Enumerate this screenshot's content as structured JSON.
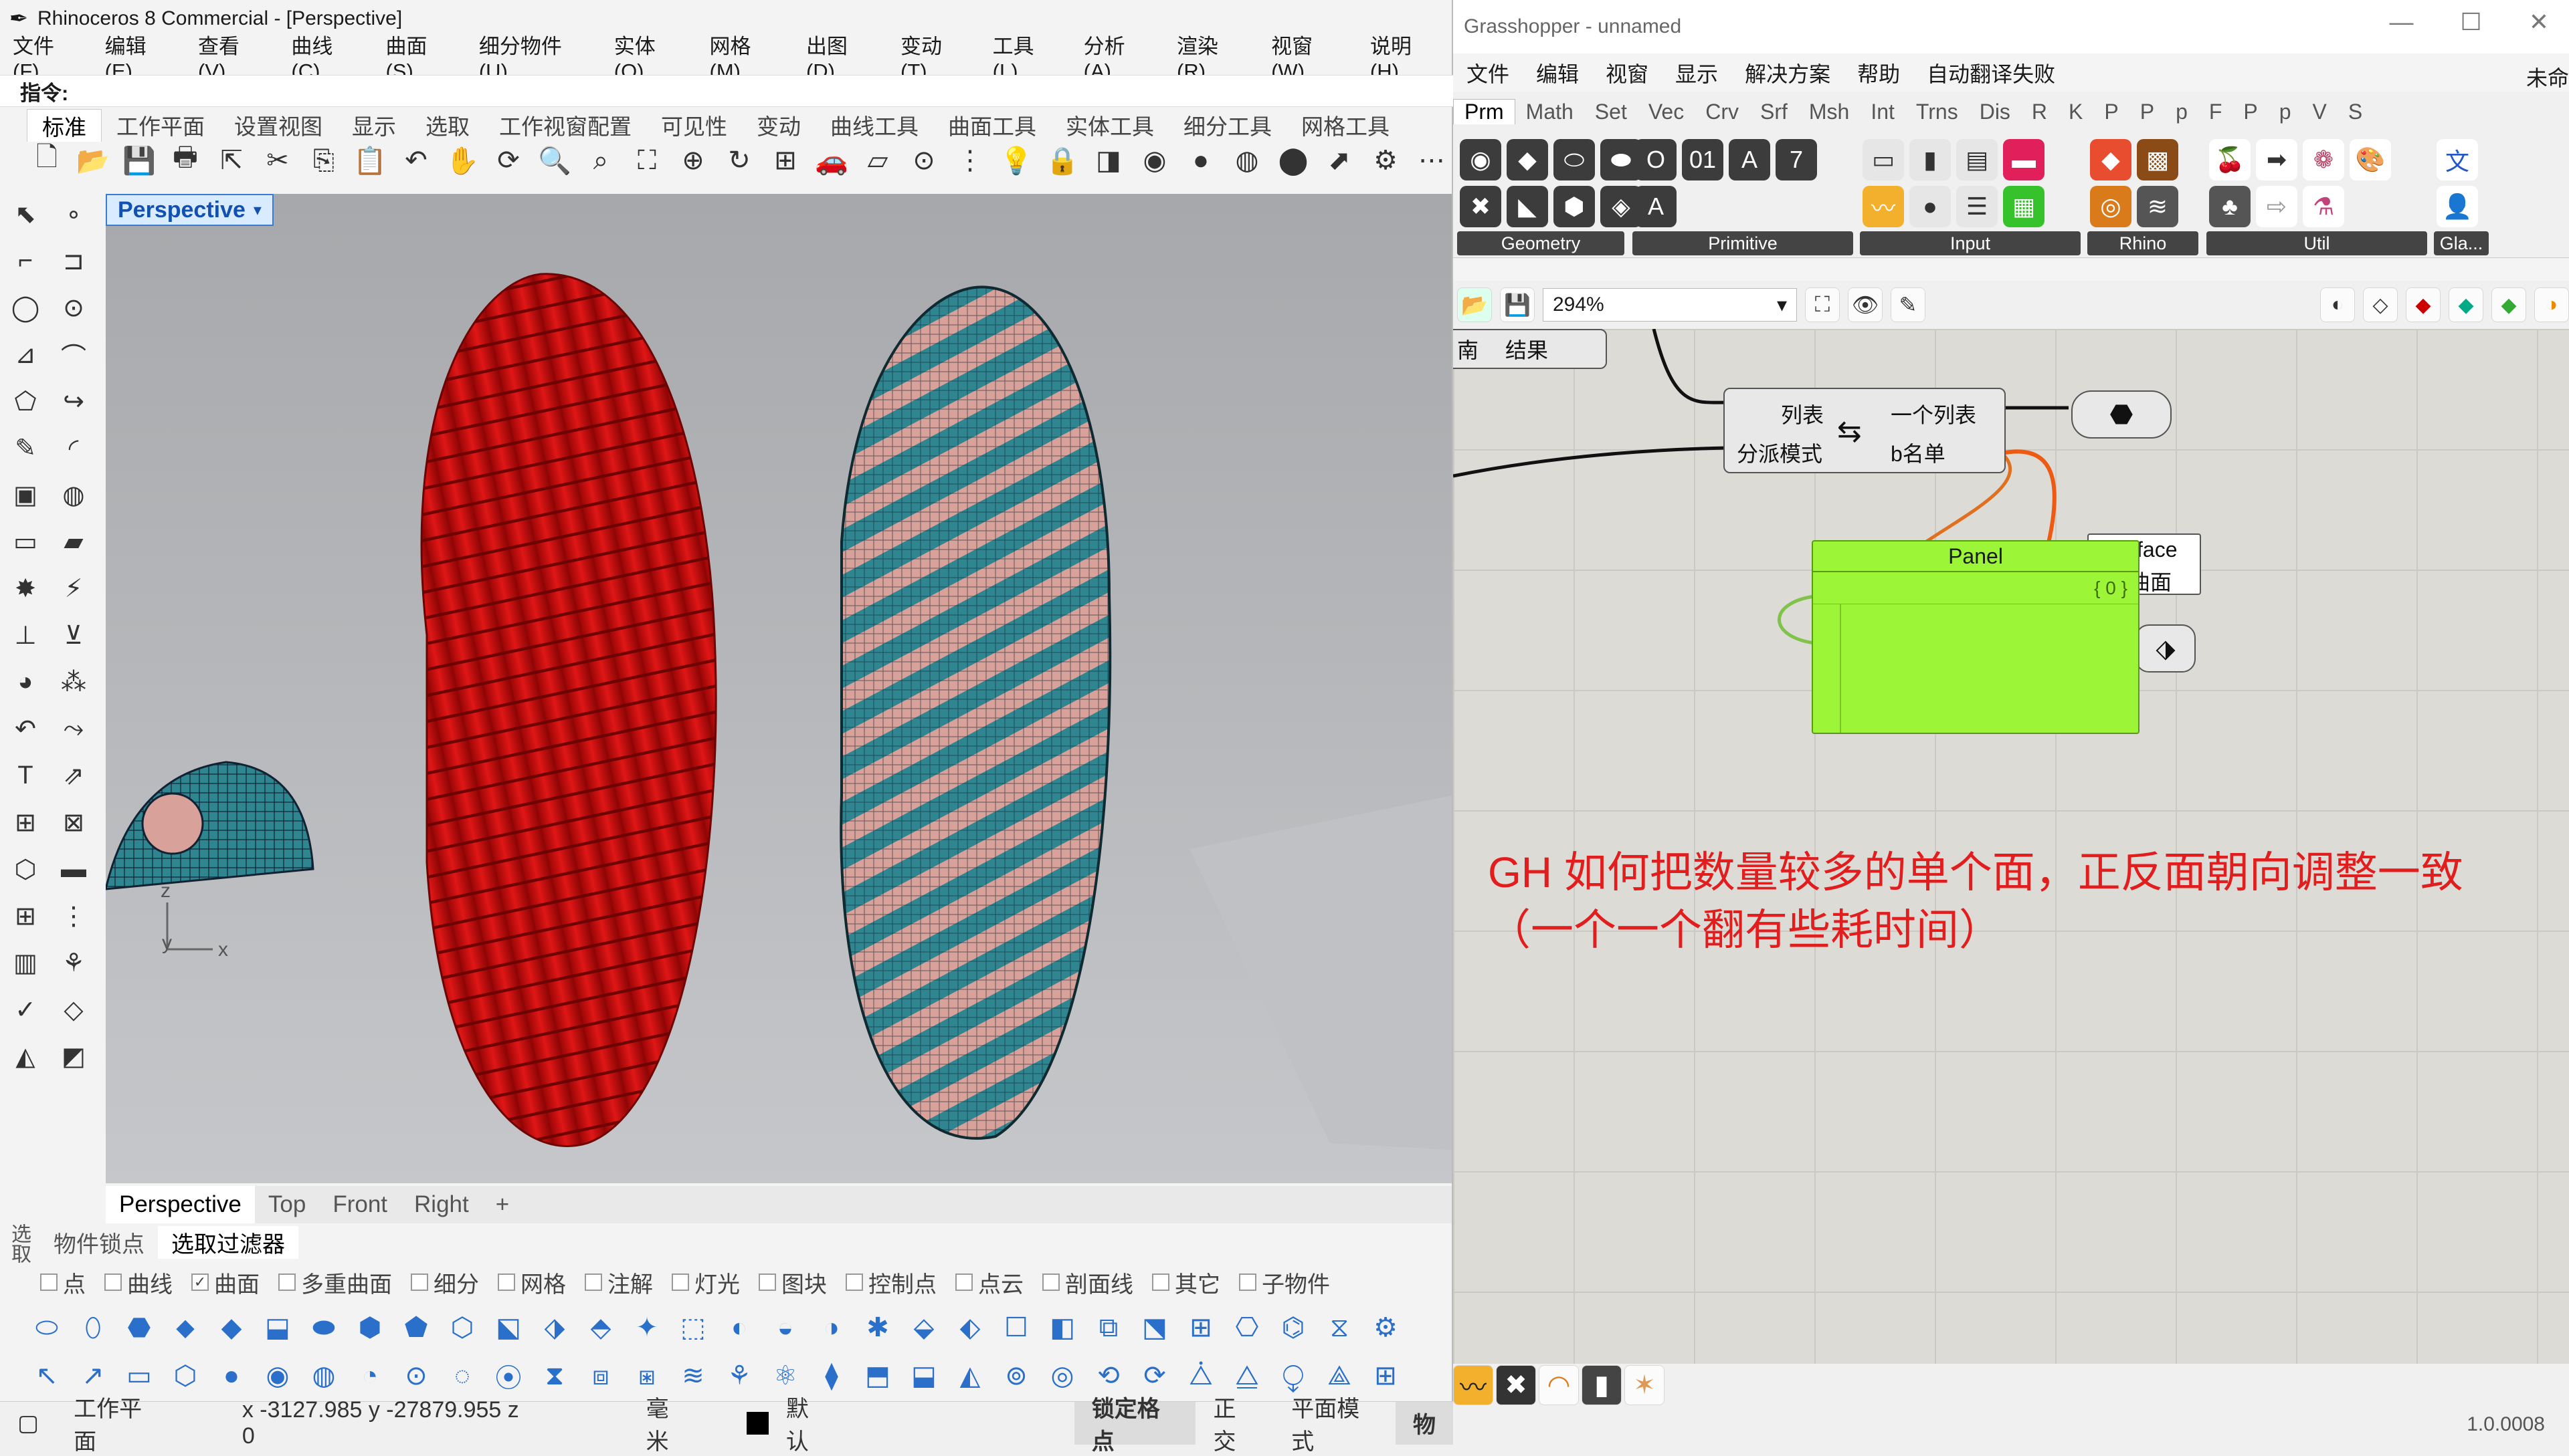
{
  "rhino": {
    "title": "Rhinoceros 8 Commercial - [Perspective]",
    "menu": [
      "文件(F)",
      "编辑(E)",
      "查看(V)",
      "曲线(C)",
      "曲面(S)",
      "细分物件(U)",
      "实体(O)",
      "网格(M)",
      "出图(D)",
      "变动(T)",
      "工具(L)",
      "分析(A)",
      "渲染(R)",
      "视窗(W)",
      "说明(H)"
    ],
    "command_label": "指令:",
    "toolbar_tabs": [
      "标准",
      "工作平面",
      "设置视图",
      "显示",
      "选取",
      "工作视窗配置",
      "可见性",
      "变动",
      "曲线工具",
      "曲面工具",
      "实体工具",
      "细分工具",
      "网格工具"
    ],
    "viewport_title": "Perspective",
    "axis_labels": {
      "z": "z",
      "y": "y",
      "x": "x"
    },
    "view_tabs": [
      "Perspective",
      "Top",
      "Front",
      "Right"
    ],
    "add_tab": "+",
    "panel_tabs": [
      "物件锁点",
      "选取过滤器"
    ],
    "side_label": "选取",
    "filters": [
      {
        "label": "点",
        "checked": false
      },
      {
        "label": "曲线",
        "checked": false
      },
      {
        "label": "曲面",
        "checked": true
      },
      {
        "label": "多重曲面",
        "checked": false
      },
      {
        "label": "细分",
        "checked": false
      },
      {
        "label": "网格",
        "checked": false
      },
      {
        "label": "注解",
        "checked": false
      },
      {
        "label": "灯光",
        "checked": false
      },
      {
        "label": "图块",
        "checked": false
      },
      {
        "label": "控制点",
        "checked": false
      },
      {
        "label": "点云",
        "checked": false
      },
      {
        "label": "剖面线",
        "checked": false
      },
      {
        "label": "其它",
        "checked": false
      },
      {
        "label": "子物件",
        "checked": false
      }
    ],
    "status": {
      "cplane": "工作平面",
      "coords": "x -3127.985  y -27879.955  z 0",
      "units": "毫米",
      "layer": "默认",
      "grid_snap": "锁定格点",
      "ortho": "正交",
      "planar": "平面模式",
      "osnap_cut": "物"
    },
    "colors": {
      "red_shape": "#cc0d0d",
      "teal": "#2f8590",
      "pink": "#d8a19a",
      "viewport": "#b4b6b9"
    }
  },
  "gh": {
    "title": "Grasshopper - unnamed",
    "menu": [
      "文件",
      "编辑",
      "视窗",
      "显示",
      "解决方案",
      "帮助",
      "自动翻译失败"
    ],
    "menu_right": "未命",
    "tabs": [
      "Prm",
      "Math",
      "Set",
      "Vec",
      "Crv",
      "Srf",
      "Msh",
      "Int",
      "Trns",
      "Dis",
      "R",
      "K",
      "P",
      "P",
      "p",
      "F",
      "P",
      "p",
      "V",
      "S"
    ],
    "groups": [
      "Geometry",
      "Primitive",
      "Input",
      "Rhino",
      "Util",
      "Gla..."
    ],
    "zoom": "294%",
    "canvas": {
      "partial_left": {
        "a": "南",
        "b": "结果"
      },
      "dispatch": {
        "in1": "列表",
        "in2": "分派模式",
        "out1": "一个列表",
        "out2": "b名单"
      },
      "panel": {
        "title": "Panel",
        "count": "{ 0 }"
      },
      "surface_label": {
        "a": "face",
        "b": "曲面"
      },
      "note": "GH 如何把数量较多的单个面，正反面朝向调整一致\n（一个一个翻有些耗时间）"
    },
    "version": "1.0.0008"
  }
}
